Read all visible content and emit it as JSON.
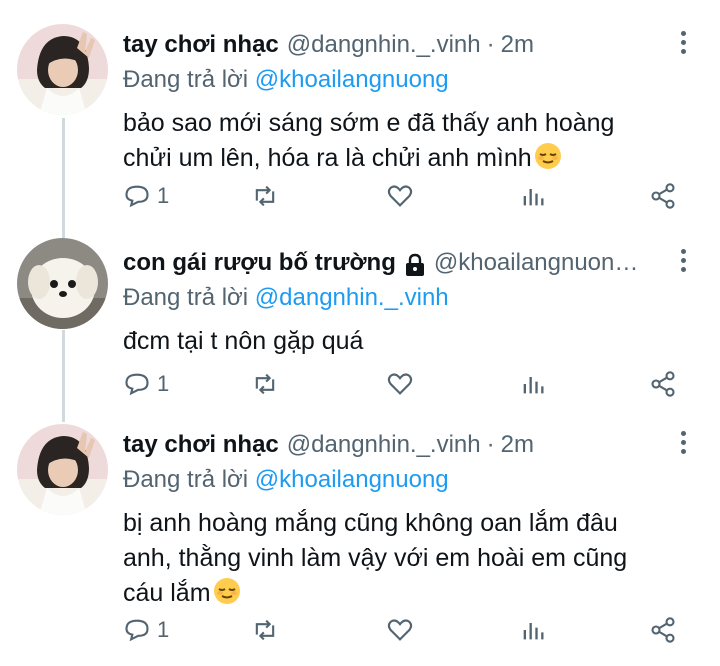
{
  "tweets": [
    {
      "name": "tay chơi nhạc",
      "handle": "@dangnhin._.vinh",
      "time": "2m",
      "reply_label": "Đang trả lời",
      "reply_to": "@khoailangnuong",
      "text": "bảo sao mới sáng sớm e đã thấy anh hoàng chửi um lên, hóa ra là chửi anh mình",
      "emoji": "relieved-face",
      "reply_count": "1",
      "locked": false
    },
    {
      "name": "con gái rượu bố trường",
      "handle": "@khoailangnuon…",
      "time": "",
      "reply_label": "Đang trả lời",
      "reply_to": "@dangnhin._.vinh",
      "text": "đcm tại t nôn gặp quá",
      "emoji": "",
      "reply_count": "1",
      "locked": true
    },
    {
      "name": "tay chơi nhạc",
      "handle": "@dangnhin._.vinh",
      "time": "2m",
      "reply_label": "Đang trả lời",
      "reply_to": "@khoailangnuong",
      "text": "bị anh hoàng mắng cũng không oan lắm đâu anh, thằng vinh làm vậy với em hoài em cũng cáu lắm",
      "emoji": "relieved-face",
      "reply_count": "1",
      "locked": false
    }
  ],
  "icons": [
    "reply-icon",
    "retweet-icon",
    "like-icon",
    "analytics-icon",
    "share-icon",
    "more-icon",
    "lock-icon"
  ],
  "colors": {
    "muted": "#536471",
    "link": "#1d9bf0",
    "text": "#0f1419",
    "thread_line": "#cfd9de"
  }
}
